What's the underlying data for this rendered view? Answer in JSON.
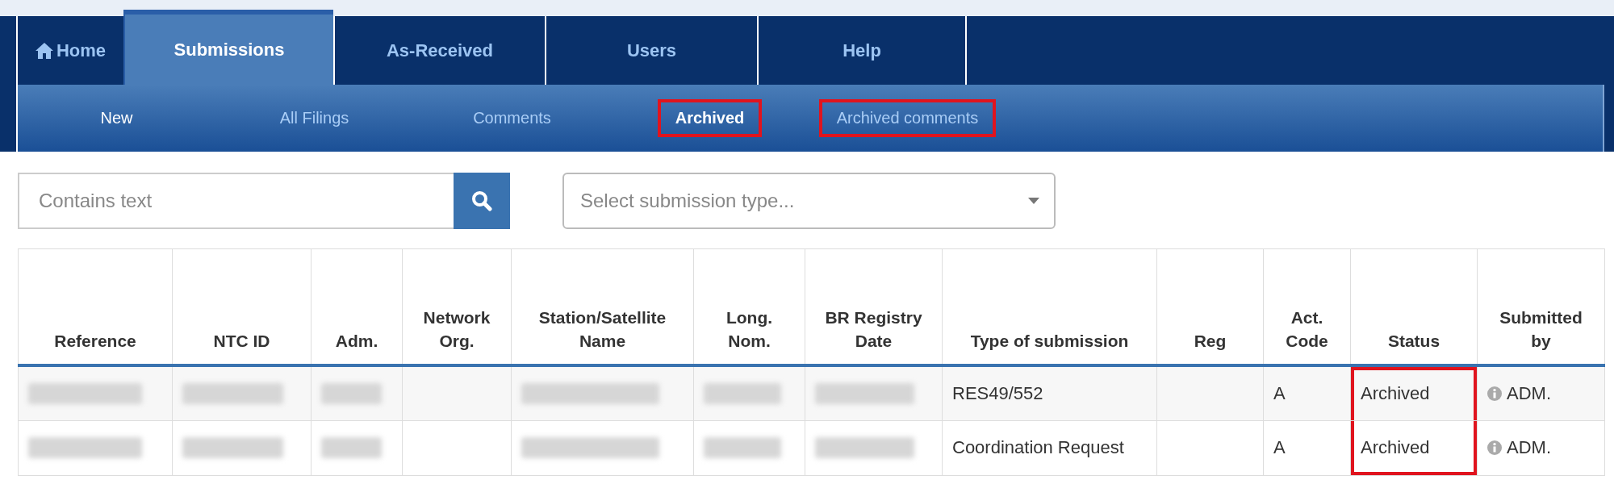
{
  "main_tabs": [
    {
      "label": "Home",
      "kind": "home",
      "selected": false
    },
    {
      "label": "Submissions",
      "kind": "text",
      "selected": true
    },
    {
      "label": "As-Received",
      "kind": "text",
      "selected": false
    },
    {
      "label": "Users",
      "kind": "text",
      "selected": false
    },
    {
      "label": "Help",
      "kind": "text",
      "selected": false
    }
  ],
  "sub_tabs": [
    {
      "label": "New",
      "selected": false,
      "bright": true,
      "highlighted": false
    },
    {
      "label": "All Filings",
      "selected": false,
      "bright": false,
      "highlighted": false
    },
    {
      "label": "Comments",
      "selected": false,
      "bright": false,
      "highlighted": false
    },
    {
      "label": "Archived",
      "selected": true,
      "bright": true,
      "highlighted": true
    },
    {
      "label": "Archived comments",
      "selected": false,
      "bright": false,
      "highlighted": true
    }
  ],
  "search": {
    "placeholder": "Contains text"
  },
  "type_select": {
    "placeholder": "Select submission type..."
  },
  "table": {
    "columns": [
      "Reference",
      "NTC ID",
      "Adm.",
      "Network Org.",
      "Station/Satellite Name",
      "Long. Nom.",
      "BR Registry Date",
      "Type of submission",
      "Reg",
      "Act. Code",
      "Status",
      "Submitted by"
    ],
    "rows": [
      {
        "cells": [
          {
            "kind": "blurred"
          },
          {
            "kind": "blurred"
          },
          {
            "kind": "blurred"
          },
          {
            "kind": "empty"
          },
          {
            "kind": "blurred"
          },
          {
            "kind": "blurred"
          },
          {
            "kind": "blurred"
          },
          {
            "kind": "text",
            "text": "RES49/552"
          },
          {
            "kind": "empty"
          },
          {
            "kind": "text",
            "text": "A"
          },
          {
            "kind": "text",
            "text": "Archived",
            "highlighted": true
          },
          {
            "kind": "info",
            "text": "ADM."
          }
        ]
      },
      {
        "cells": [
          {
            "kind": "blurred"
          },
          {
            "kind": "blurred"
          },
          {
            "kind": "blurred"
          },
          {
            "kind": "empty"
          },
          {
            "kind": "blurred"
          },
          {
            "kind": "blurred"
          },
          {
            "kind": "blurred"
          },
          {
            "kind": "text",
            "text": "Coordination Request"
          },
          {
            "kind": "empty"
          },
          {
            "kind": "text",
            "text": "A"
          },
          {
            "kind": "text",
            "text": "Archived",
            "highlighted": true
          },
          {
            "kind": "info",
            "text": "ADM."
          }
        ]
      }
    ]
  }
}
